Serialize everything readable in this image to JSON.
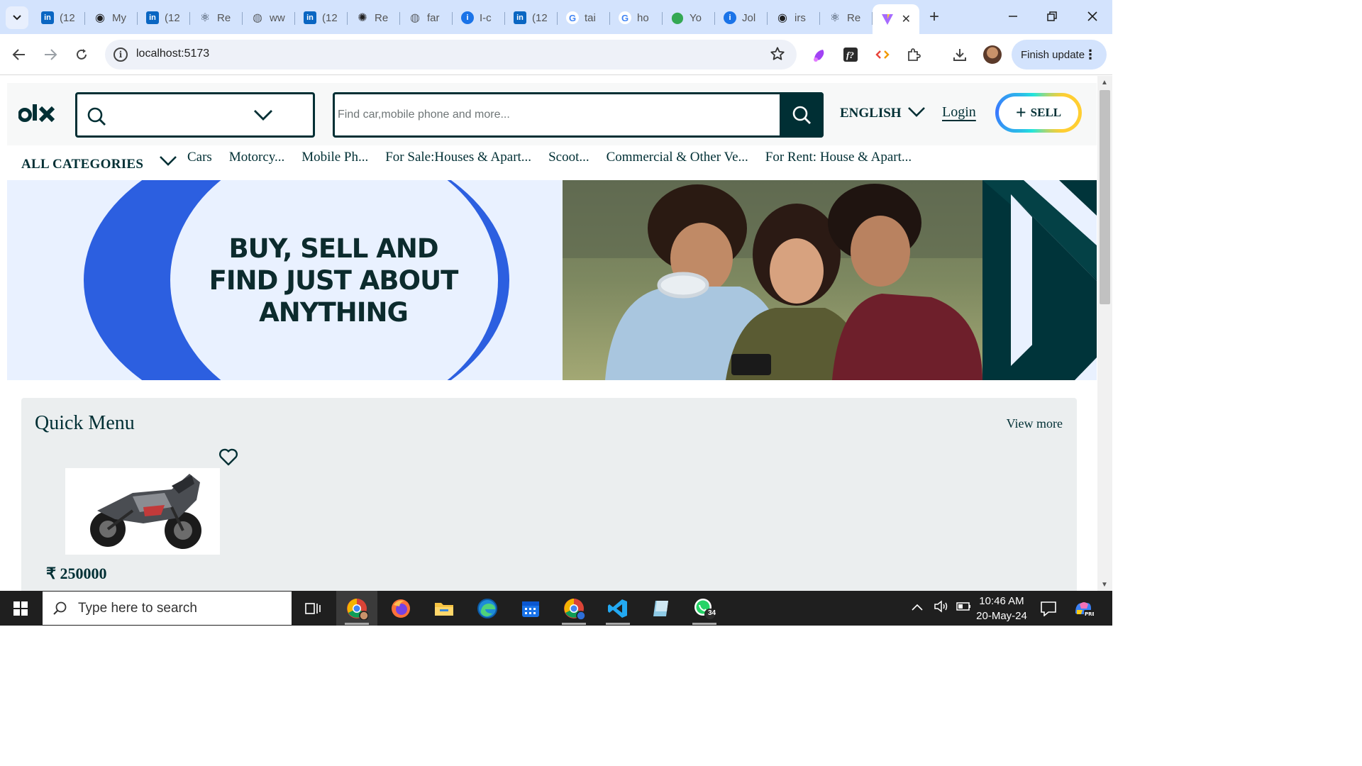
{
  "browser": {
    "tabs": [
      {
        "title": "(12",
        "icon": "linkedin-icon",
        "color": "#0a66c2"
      },
      {
        "title": "My",
        "icon": "github-icon",
        "color": "#1f1f1f"
      },
      {
        "title": "(12",
        "icon": "linkedin-icon",
        "color": "#0a66c2"
      },
      {
        "title": "Re",
        "icon": "react-icon",
        "color": "#1f2d3d"
      },
      {
        "title": "ww",
        "icon": "globe-icon",
        "color": "#5f6368"
      },
      {
        "title": "(12",
        "icon": "linkedin-icon",
        "color": "#0a66c2"
      },
      {
        "title": "Re",
        "icon": "openai-icon",
        "color": "#1f1f1f"
      },
      {
        "title": "far",
        "icon": "globe-icon",
        "color": "#5f6368"
      },
      {
        "title": "I-c",
        "icon": "info-tab-icon",
        "color": "#1a73e8"
      },
      {
        "title": "(12",
        "icon": "linkedin-icon",
        "color": "#0a66c2"
      },
      {
        "title": "tai",
        "icon": "google-icon",
        "color": "#4285f4"
      },
      {
        "title": "ho",
        "icon": "google-icon",
        "color": "#4285f4"
      },
      {
        "title": "Yo",
        "icon": "maps-pin-icon",
        "color": "#34a853"
      },
      {
        "title": "Jol",
        "icon": "info-tab-icon",
        "color": "#1a73e8"
      },
      {
        "title": "irs",
        "icon": "github-icon",
        "color": "#1f1f1f"
      },
      {
        "title": "Re",
        "icon": "react-icon",
        "color": "#1f2d3d"
      }
    ],
    "active_tab_icon": "vite-icon",
    "url": "localhost:5173",
    "finish_update_label": "Finish update"
  },
  "olx": {
    "logo_text": "olx",
    "search_placeholder": "Find car,mobile phone and more...",
    "language": "ENGLISH",
    "login_label": "Login",
    "sell_label": "SELL",
    "all_categories": "ALL CATEGORIES",
    "categories": [
      "Cars",
      "Motorcy...",
      "Mobile Ph...",
      "For Sale:Houses & Apart...",
      "Scoot...",
      "Commercial & Other Ve...",
      "For Rent: House & Apart..."
    ],
    "banner_lines": [
      "BUY, SELL AND",
      "FIND JUST ABOUT",
      "ANYTHING"
    ],
    "quick_menu": {
      "title": "Quick Menu",
      "view_more": "View more",
      "products": [
        {
          "price": "₹ 250000",
          "image": "motorcycle-image"
        }
      ]
    },
    "colors": {
      "primary": "#002f34",
      "banner_blue": "#2c5fe0",
      "banner_bg": "#e9f1ff"
    }
  },
  "taskbar": {
    "search_placeholder": "Type here to search",
    "time": "10:46 AM",
    "date": "20-May-24",
    "whatsapp_badge": "34"
  }
}
